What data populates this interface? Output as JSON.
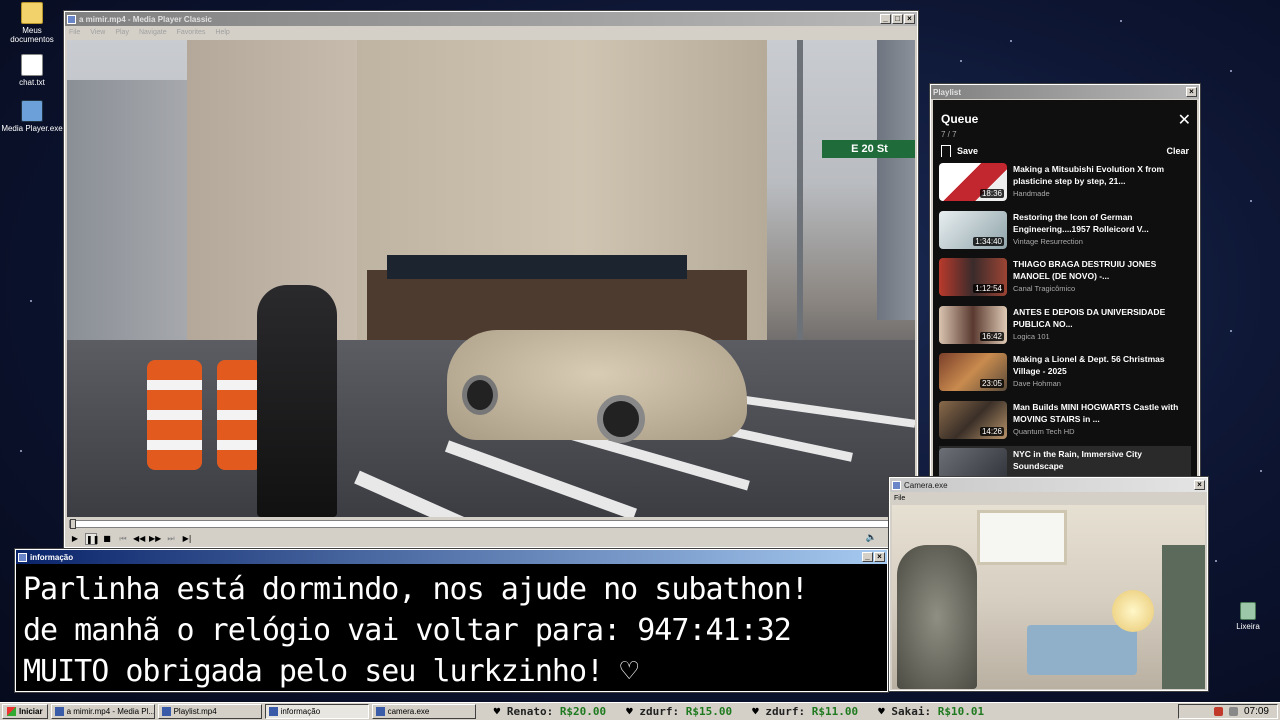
{
  "desktop": {
    "icons": [
      {
        "label": "Meus documentos"
      },
      {
        "label": "chat.txt"
      },
      {
        "label": "Media Player.exe"
      },
      {
        "label": "Lixeira"
      }
    ]
  },
  "mpc": {
    "title": "a mimir.mp4 - Media Player Classic",
    "menu": [
      "File",
      "View",
      "Play",
      "Navigate",
      "Favorites",
      "Help"
    ],
    "street_sign": "E 20 St",
    "progress": 0.0
  },
  "playlist": {
    "window_title": "Playlist",
    "heading": "Queue",
    "count": "7 / 7",
    "save_label": "Save",
    "clear_label": "Clear",
    "items": [
      {
        "title": "Making a Mitsubishi Evolution X from plasticine step by step, 21...",
        "channel": "Handmade",
        "duration": "18:36"
      },
      {
        "title": "Restoring the Icon of German Engineering....1957 Rolleicord V...",
        "channel": "Vintage Resurrection",
        "duration": "1:34:40"
      },
      {
        "title": "THIAGO BRAGA DESTRUIU JONES MANOEL (DE NOVO) -...",
        "channel": "Canal Tragicômico",
        "duration": "1:12:54"
      },
      {
        "title": "ANTES E DEPOIS DA UNIVERSIDADE PUBLICA NO...",
        "channel": "Logica 101",
        "duration": "16:42"
      },
      {
        "title": "Making a Lionel & Dept. 56 Christmas Village - 2025",
        "channel": "Dave Hohman",
        "duration": "23:05"
      },
      {
        "title": "Man Builds MINI HOGWARTS Castle with MOVING STAIRS in ...",
        "channel": "Quantum Tech HD",
        "duration": "14:26"
      },
      {
        "title": "NYC in the Rain, Immersive City Soundscape",
        "channel": "",
        "duration": ""
      }
    ]
  },
  "info": {
    "window_title": "informação",
    "lines": [
      "Parlinha está dormindo, nos ajude no subathon!",
      "de manhã o relógio vai voltar para:  947:41:32",
      "MUITO obrigada pelo seu lurkzinho! ♡"
    ]
  },
  "camera": {
    "window_title": "Camera.exe",
    "menu_file": "File"
  },
  "taskbar": {
    "start_label": "Iniciar",
    "tasks": [
      {
        "label": "a mimir.mp4 - Media Pl..."
      },
      {
        "label": "Playlist.mp4"
      },
      {
        "label": "informação"
      },
      {
        "label": "camera.exe"
      }
    ],
    "ticker": [
      {
        "name": "Renato:",
        "amount": "R$20.00"
      },
      {
        "name": "zdurf:",
        "amount": "R$15.00"
      },
      {
        "name": "zdurf:",
        "amount": "R$11.00"
      },
      {
        "name": "Sakai:",
        "amount": "R$10.01"
      }
    ],
    "clock": "07:09"
  }
}
